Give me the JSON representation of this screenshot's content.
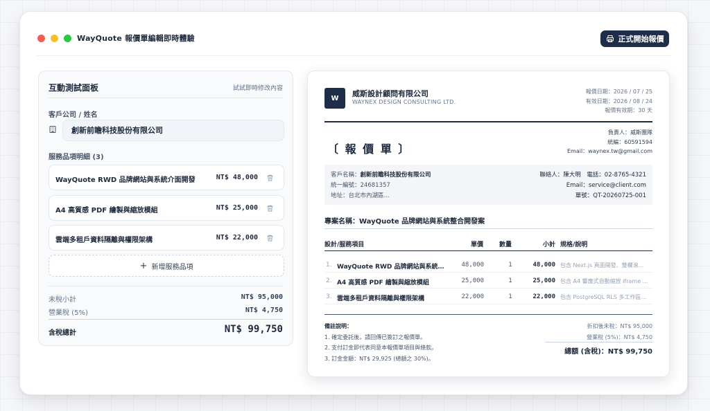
{
  "app": {
    "title": "WayQuote 報價單編輯即時體驗",
    "start_button": "正式開始報價"
  },
  "panel": {
    "title": "互動測試面板",
    "hint": "試試即時修改內容",
    "client_label": "客戶公司 / 姓名",
    "client_value": "創新前瞻科技股份有限公司",
    "services_label": "服務品項明細 (3)",
    "services": [
      {
        "name": "WayQuote RWD 品牌網站與系統介面開發",
        "price": "NT$ 48,000"
      },
      {
        "name": "A4 高質感 PDF 繪製與縮放模組",
        "price": "NT$ 25,000"
      },
      {
        "name": "雲端多租戶資料隔離與權限架構",
        "price": "NT$ 22,000"
      }
    ],
    "add_label": "新增服務品項",
    "subtotal_label": "未稅小計",
    "subtotal_value": "NT$ 95,000",
    "tax_label": "營業稅 (5%)",
    "tax_value": "NT$ 4,750",
    "total_label": "含稅總計",
    "total_value": "NT$ 99,750"
  },
  "quote": {
    "logo": "W",
    "company": "威斯設計顧問有限公司",
    "company_en": "WAYNEX DESIGN CONSULTING LTD.",
    "dates": [
      "報價日期：2026 / 07 / 25",
      "有效日期：2026 / 08 / 24",
      "報價有效期：30 天"
    ],
    "title": "〔 報 價 單 〕",
    "owner": [
      "負責人：威斯團隊",
      "統編：60591594",
      "Email：waynex.tw@gmail.com"
    ],
    "client_left": [
      {
        "k": "客戶名稱：",
        "v": "創新前瞻科技股份有限公司"
      },
      {
        "k": "統一編號：",
        "v": "24681357"
      },
      {
        "k": "地址：",
        "v": "台北市內湖區..."
      }
    ],
    "client_right": [
      "聯絡人：陳大明　電話：02-8765-4321",
      "Email：service@client.com",
      "單號：QT-20260725-001"
    ],
    "project": "專案名稱：WayQuote 品牌網站與系統整合開發案",
    "headers": {
      "item": "設計/服務項目",
      "unit": "單價",
      "qty": "數量",
      "sub": "小計",
      "spec": "規格/說明"
    },
    "rows": [
      {
        "no": "1.",
        "name": "WayQuote RWD 品牌網站與系統介...",
        "unit": "48,000",
        "qty": "1",
        "sub": "48,000",
        "spec": "包含 Next.js 頁面開發、雙欄滾..."
      },
      {
        "no": "2.",
        "name": "A4 高質感 PDF 繪製與縮放模組",
        "unit": "25,000",
        "qty": "1",
        "sub": "25,000",
        "spec": "包含 A4 響應式自動縮放 iframe ..."
      },
      {
        "no": "3.",
        "name": "雲端多租戶資料隔離與權限架構",
        "unit": "22,000",
        "qty": "1",
        "sub": "22,000",
        "spec": "包含 PostgreSQL RLS 多工作區..."
      }
    ],
    "notes_title": "備註說明：",
    "notes": [
      "1. 確定委託後，請回傳已簽訂之報價單。",
      "2. 支付訂金即代表同意本報價單項目與條款。",
      "3. 訂金金額：NT$ 29,925 (總額之 30%)。"
    ],
    "sum_lines": [
      "折扣後未稅：NT$ 95,000",
      "營業稅 (5%)：NT$ 4,750"
    ],
    "grand_total": "總額 (含稅)：NT$ 99,750"
  }
}
